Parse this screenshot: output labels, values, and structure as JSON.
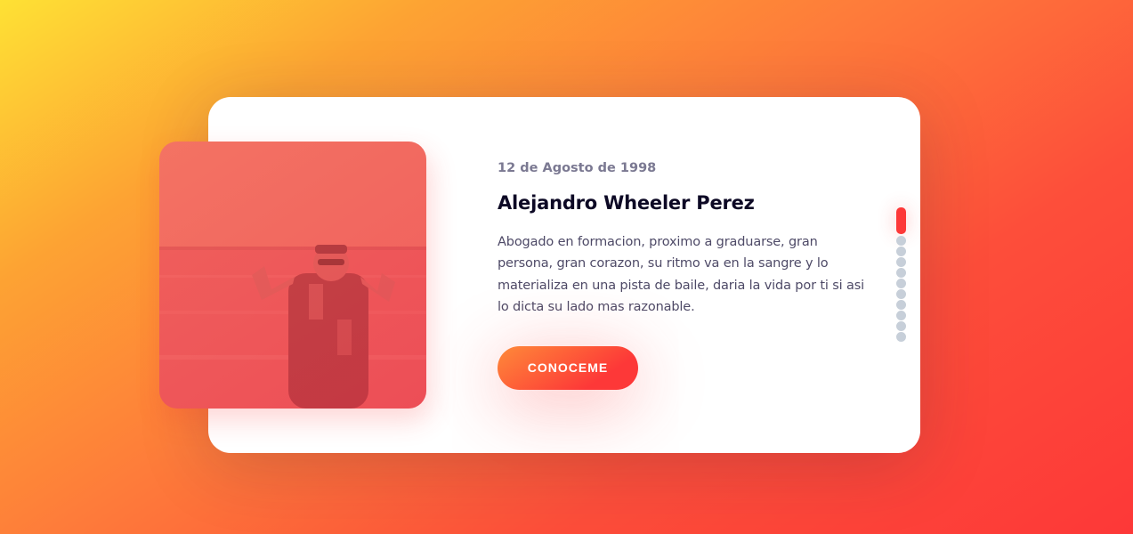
{
  "slide": {
    "date": "12 de Agosto de 1998",
    "title": "Alejandro Wheeler Perez",
    "description": "Abogado en formacion, proximo a graduarse, gran persona, gran corazon, su ritmo va en la sangre y lo materializa en una pista de baile, daria la vida por ti si asi lo dicta su lado mas razonable.",
    "button_label": "CONOCEME",
    "photo_alt": "Alejandro Wheeler Perez at the beach"
  },
  "pagination": {
    "total": 11,
    "active_index": 0
  },
  "colors": {
    "accent": "#fd3838",
    "accent_orange": "#fe8a39",
    "title": "#0d0925",
    "muted": "#7b7992",
    "dot_inactive": "#c7cfd9"
  }
}
